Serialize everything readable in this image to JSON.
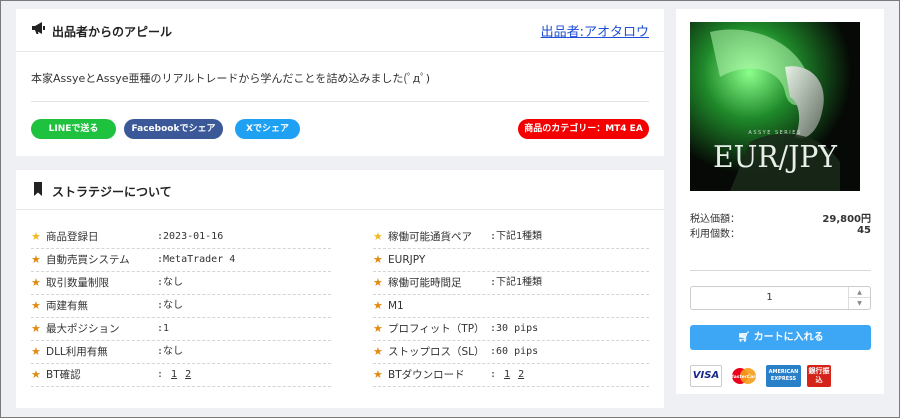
{
  "appeal": {
    "title": "出品者からのアピール",
    "seller_link": "出品者:アオタロウ",
    "text": "本家AssyeとAssye亜種のリアルトレードから学んだことを詰め込みました(ﾟдﾟ)",
    "buttons": {
      "line": "LINEで送る",
      "facebook": "Facebookでシェア",
      "x": "Xでシェア",
      "category": "商品のカテゴリー：MT4 EA"
    }
  },
  "strategy": {
    "title": "ストラテジーについて",
    "left_rows": [
      {
        "label": "商品登録日",
        "value": ":2023-01-16"
      },
      {
        "label": "自動売買システム",
        "value": ":MetaTrader 4"
      },
      {
        "label": "取引数量制限",
        "value": ":なし"
      },
      {
        "label": "両建有無",
        "value": ":なし"
      },
      {
        "label": "最大ポジション",
        "value": ":1"
      },
      {
        "label": "DLL利用有無",
        "value": ":なし"
      },
      {
        "label": "BT確認",
        "value": ":",
        "links": [
          "1",
          "2"
        ]
      }
    ],
    "right_rows": [
      {
        "label": "稼働可能通貨ペア",
        "value": ":下記1種類"
      },
      {
        "label": "EURJPY",
        "value": ""
      },
      {
        "label": "稼働可能時間足",
        "value": ":下記1種類"
      },
      {
        "label": "M1",
        "value": ""
      },
      {
        "label": "プロフィット（TP）",
        "value": ":30 pips"
      },
      {
        "label": "ストップロス（SL）",
        "value": ":60 pips"
      },
      {
        "label": "BTダウンロード",
        "value": ":",
        "links": [
          "1",
          "2"
        ]
      }
    ]
  },
  "product": {
    "image_subtitle": "ASSYE SERIES",
    "image_title": "EUR/JPY",
    "price_label": "税込価額：",
    "price_value": "29,800円",
    "usage_label": "利用個数：",
    "usage_value": "45",
    "quantity": "1",
    "cart_label": "カートに入れる",
    "payment": {
      "visa": "VISA",
      "mastercard": "MasterCard",
      "amex": "AMERICAN EXPRESS",
      "bank": "銀行振込"
    }
  },
  "colors": {
    "line": "#1fc23f",
    "facebook": "#3b5998",
    "x": "#1ea1f2",
    "category": "#f40000",
    "cart": "#3ea7f5",
    "star": "#f2b81e"
  }
}
